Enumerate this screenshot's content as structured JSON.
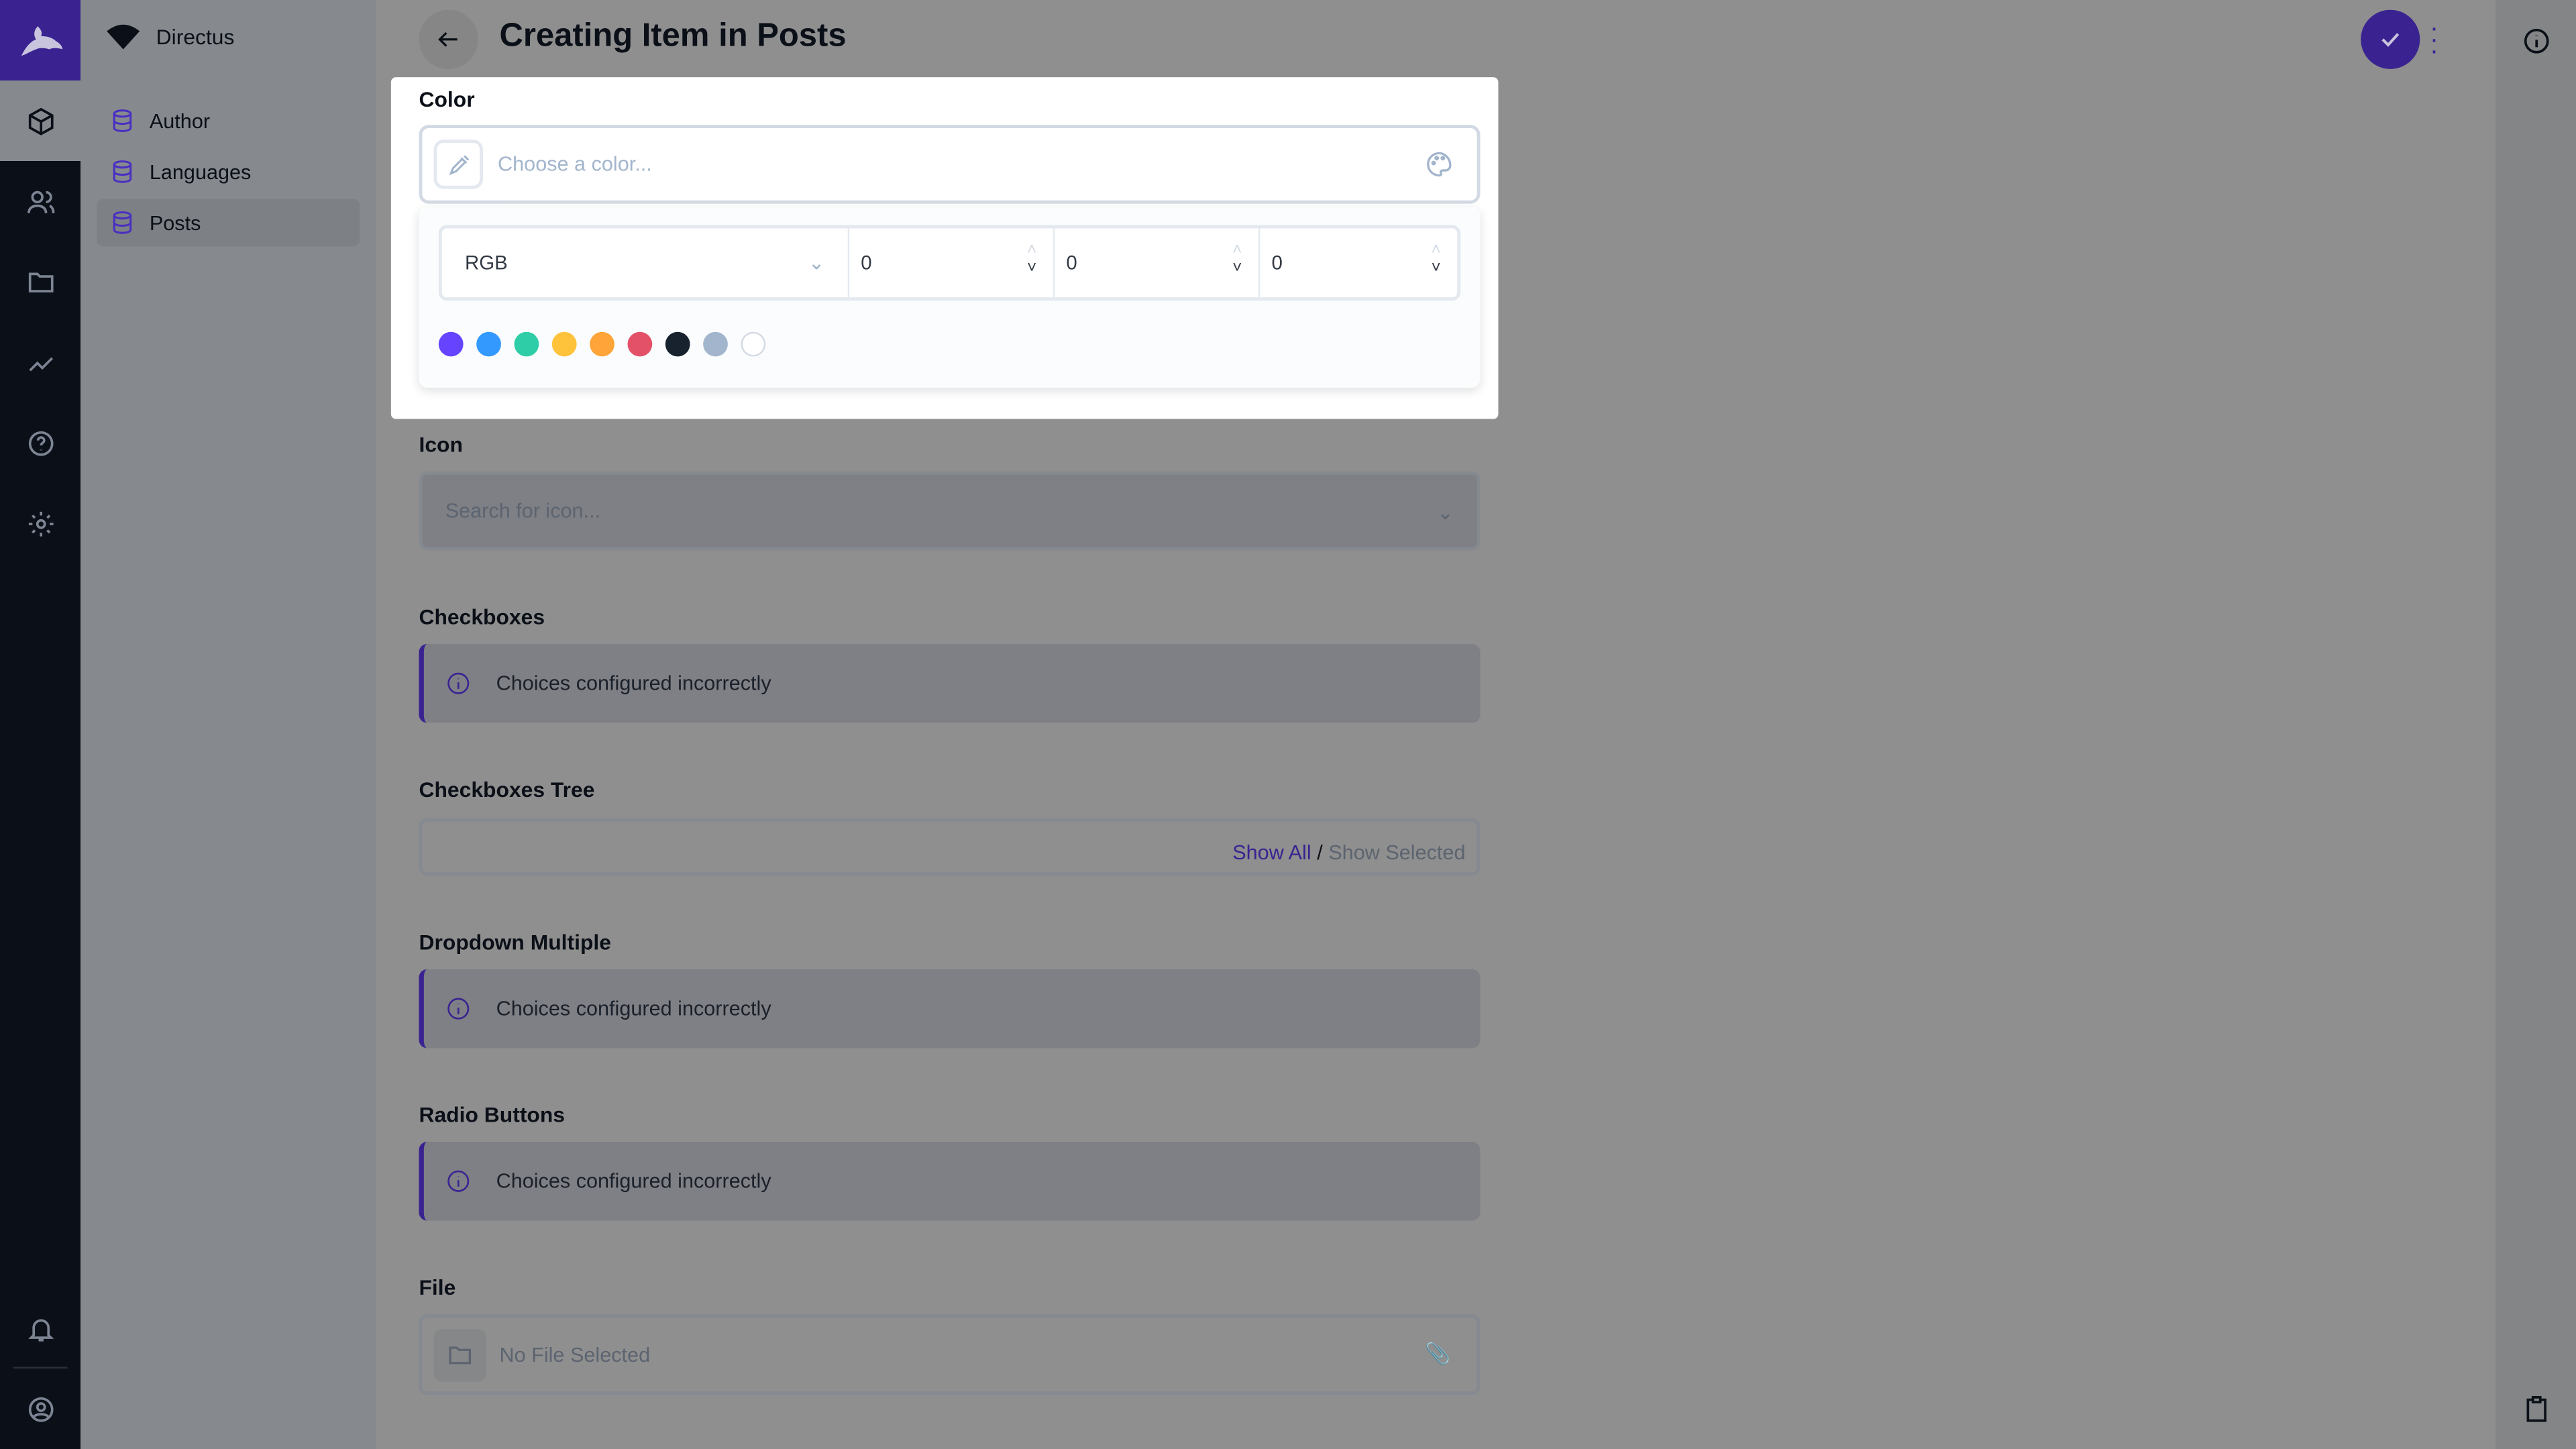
{
  "project": {
    "name": "Directus"
  },
  "sidebar": {
    "items": [
      {
        "label": "Author"
      },
      {
        "label": "Languages"
      },
      {
        "label": "Posts",
        "selected": true
      }
    ]
  },
  "header": {
    "title": "Creating Item in Posts"
  },
  "fields": {
    "color": {
      "label": "Color",
      "placeholder": "Choose a color...",
      "mode": "RGB",
      "values": [
        "0",
        "0",
        "0"
      ],
      "presets": [
        "#6644ff",
        "#3399ff",
        "#2ecda7",
        "#ffc23b",
        "#ffa439",
        "#e35169",
        "#18222f",
        "#a2b5cd",
        "#ffffff"
      ]
    },
    "icon": {
      "label": "Icon",
      "placeholder": "Search for icon..."
    },
    "checkboxes": {
      "label": "Checkboxes",
      "notice": "Choices configured incorrectly"
    },
    "checkboxes_tree": {
      "label": "Checkboxes Tree",
      "show_all": "Show All",
      "separator": "/",
      "show_selected": "Show Selected"
    },
    "dropdown_multiple": {
      "label": "Dropdown Multiple",
      "notice": "Choices configured incorrectly"
    },
    "radio_buttons": {
      "label": "Radio Buttons",
      "notice": "Choices configured incorrectly"
    },
    "file": {
      "label": "File",
      "placeholder": "No File Selected"
    }
  },
  "colors": {
    "accent": "#6644ff",
    "nav": "#0b0f17"
  }
}
